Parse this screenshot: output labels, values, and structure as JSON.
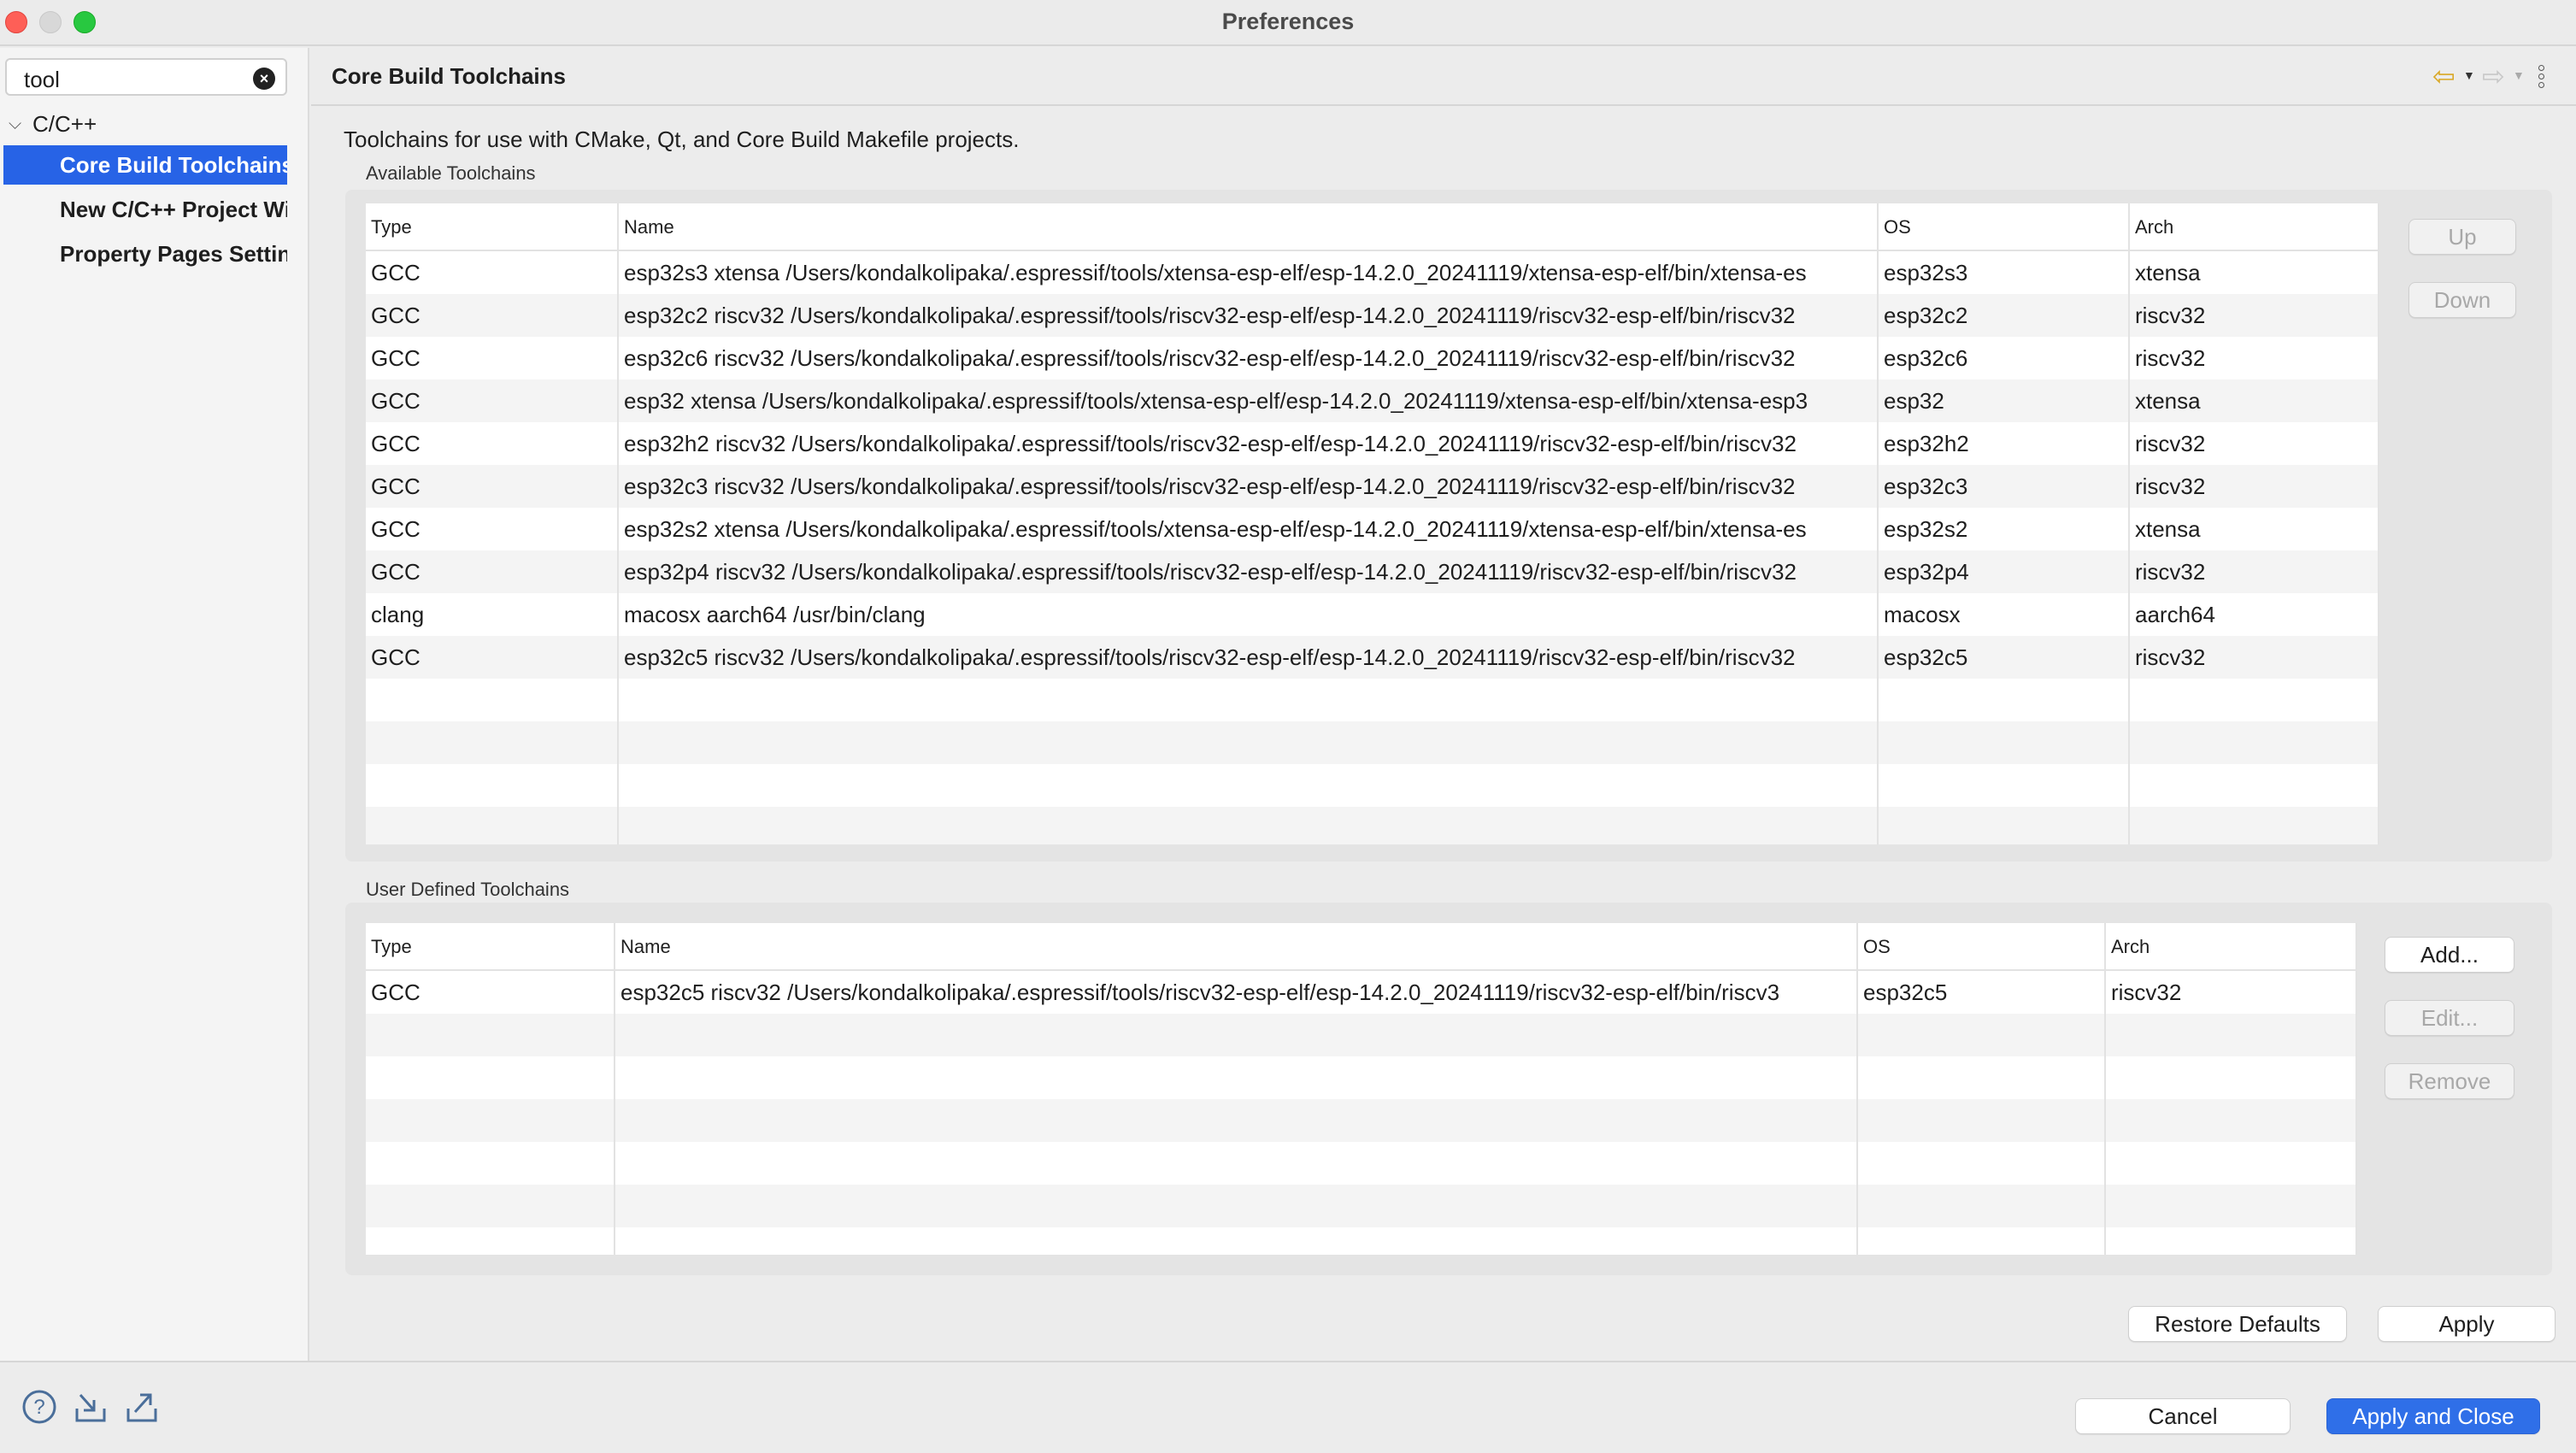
{
  "window": {
    "title": "Preferences"
  },
  "sidebar": {
    "search": {
      "value": "tool"
    },
    "parent": {
      "label": "C/C++"
    },
    "items": [
      {
        "label": "Core Build Toolchains",
        "selected": true
      },
      {
        "label": "New C/C++ Project Wizard"
      },
      {
        "label": "Property Pages Settings"
      }
    ]
  },
  "header": {
    "title": "Core Build Toolchains"
  },
  "description": "Toolchains for use with CMake, Qt, and Core Build Makefile projects.",
  "available": {
    "label": "Available Toolchains",
    "columns": [
      "Type",
      "Name",
      "OS",
      "Arch"
    ],
    "rows": [
      [
        "GCC",
        "esp32s3 xtensa /Users/kondalkolipaka/.espressif/tools/xtensa-esp-elf/esp-14.2.0_20241119/xtensa-esp-elf/bin/xtensa-es",
        "esp32s3",
        "xtensa"
      ],
      [
        "GCC",
        "esp32c2 riscv32 /Users/kondalkolipaka/.espressif/tools/riscv32-esp-elf/esp-14.2.0_20241119/riscv32-esp-elf/bin/riscv32",
        "esp32c2",
        "riscv32"
      ],
      [
        "GCC",
        "esp32c6 riscv32 /Users/kondalkolipaka/.espressif/tools/riscv32-esp-elf/esp-14.2.0_20241119/riscv32-esp-elf/bin/riscv32",
        "esp32c6",
        "riscv32"
      ],
      [
        "GCC",
        "esp32 xtensa /Users/kondalkolipaka/.espressif/tools/xtensa-esp-elf/esp-14.2.0_20241119/xtensa-esp-elf/bin/xtensa-esp3",
        "esp32",
        "xtensa"
      ],
      [
        "GCC",
        "esp32h2 riscv32 /Users/kondalkolipaka/.espressif/tools/riscv32-esp-elf/esp-14.2.0_20241119/riscv32-esp-elf/bin/riscv32",
        "esp32h2",
        "riscv32"
      ],
      [
        "GCC",
        "esp32c3 riscv32 /Users/kondalkolipaka/.espressif/tools/riscv32-esp-elf/esp-14.2.0_20241119/riscv32-esp-elf/bin/riscv32",
        "esp32c3",
        "riscv32"
      ],
      [
        "GCC",
        "esp32s2 xtensa /Users/kondalkolipaka/.espressif/tools/xtensa-esp-elf/esp-14.2.0_20241119/xtensa-esp-elf/bin/xtensa-es",
        "esp32s2",
        "xtensa"
      ],
      [
        "GCC",
        "esp32p4 riscv32 /Users/kondalkolipaka/.espressif/tools/riscv32-esp-elf/esp-14.2.0_20241119/riscv32-esp-elf/bin/riscv32",
        "esp32p4",
        "riscv32"
      ],
      [
        "clang",
        "macosx aarch64 /usr/bin/clang",
        "macosx",
        "aarch64"
      ],
      [
        "GCC",
        "esp32c5 riscv32 /Users/kondalkolipaka/.espressif/tools/riscv32-esp-elf/esp-14.2.0_20241119/riscv32-esp-elf/bin/riscv32",
        "esp32c5",
        "riscv32"
      ]
    ],
    "buttons": {
      "up": "Up",
      "down": "Down"
    }
  },
  "user_defined": {
    "label": "User Defined Toolchains",
    "columns": [
      "Type",
      "Name",
      "OS",
      "Arch"
    ],
    "rows": [
      [
        "GCC",
        "esp32c5 riscv32 /Users/kondalkolipaka/.espressif/tools/riscv32-esp-elf/esp-14.2.0_20241119/riscv32-esp-elf/bin/riscv3",
        "esp32c5",
        "riscv32"
      ]
    ],
    "buttons": {
      "add": "Add...",
      "edit": "Edit...",
      "remove": "Remove"
    }
  },
  "actions": {
    "restore_defaults": "Restore Defaults",
    "apply": "Apply"
  },
  "footer": {
    "cancel": "Cancel",
    "apply_close": "Apply and Close"
  },
  "icons": {
    "help": "help-icon",
    "import": "import-icon",
    "export": "export-icon",
    "back": "back-arrow-icon",
    "forward": "forward-arrow-icon",
    "menu": "view-menu-icon"
  }
}
